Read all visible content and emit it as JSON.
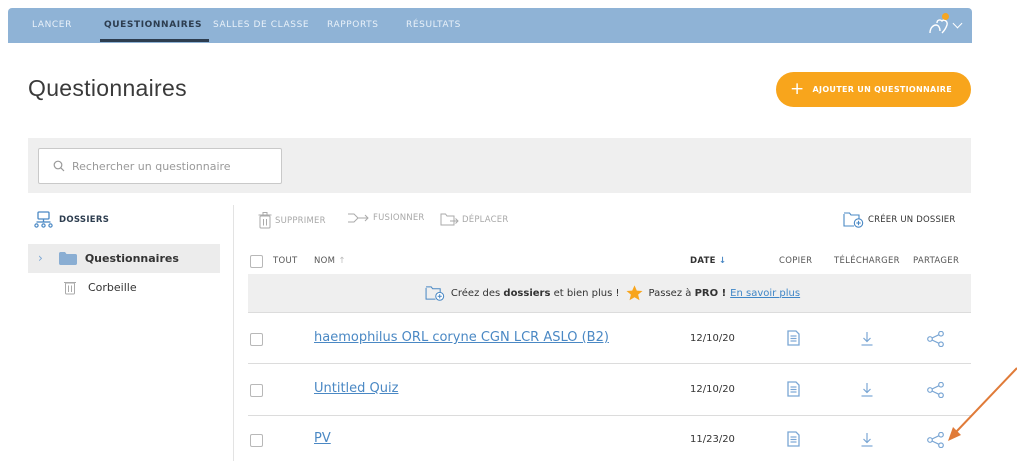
{
  "nav": {
    "items": [
      "LANCER",
      "QUESTIONNAIRES",
      "SALLES DE CLASSE",
      "RAPPORTS",
      "RÉSULTATS"
    ],
    "active": "QUESTIONNAIRES"
  },
  "page": {
    "title": "Questionnaires",
    "add_button": "AJOUTER UN QUESTIONNAIRE"
  },
  "search": {
    "placeholder": "Rechercher un questionnaire"
  },
  "sidebar": {
    "title": "DOSSIERS",
    "items": [
      {
        "label": "Questionnaires",
        "selected": true,
        "icon": "folder-icon"
      },
      {
        "label": "Corbeille",
        "selected": false,
        "icon": "trash-icon"
      }
    ]
  },
  "toolbar": {
    "delete": "SUPPRIMER",
    "merge": "FUSIONNER",
    "move": "DÉPLACER",
    "create_folder": "CRÉER UN DOSSIER"
  },
  "table": {
    "headers": {
      "all": "TOUT",
      "name": "NOM",
      "date": "DATE",
      "copy": "COPIER",
      "download": "TÉLÉCHARGER",
      "share": "PARTAGER"
    },
    "sort_indicators": {
      "name": "↑",
      "date": "↓"
    },
    "promo": {
      "part1": "Créez des",
      "bold1": "dossiers",
      "part2": "et bien plus !",
      "part3": "Passez à",
      "bold2": "PRO !",
      "link": "En savoir plus"
    },
    "rows": [
      {
        "name": "haemophilus ORL coryne CGN LCR ASLO (B2)",
        "date": "12/10/20"
      },
      {
        "name": "Untitled Quiz",
        "date": "12/10/20"
      },
      {
        "name": "PV",
        "date": "11/23/20"
      }
    ]
  },
  "colors": {
    "nav_bg": "#8fb3d6",
    "accent_orange": "#f8a51c",
    "link_blue": "#4a88c4",
    "icon_blue": "#7aa6d4",
    "annotation_arrow": "#e07b39"
  }
}
